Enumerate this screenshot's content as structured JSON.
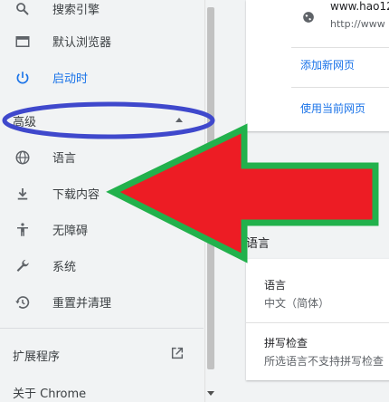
{
  "sidebar": {
    "items": [
      {
        "label": "搜索引擎",
        "icon": "search-icon"
      },
      {
        "label": "默认浏览器",
        "icon": "browser-window-icon"
      },
      {
        "label": "启动时",
        "icon": "power-icon"
      }
    ],
    "advanced": {
      "label": "高级",
      "icon": "chevron-up-icon"
    },
    "advanced_items": [
      {
        "label": "语言",
        "icon": "globe-icon"
      },
      {
        "label": "下载内容",
        "icon": "download-icon"
      },
      {
        "label": "无障碍",
        "icon": "accessibility-icon"
      },
      {
        "label": "系统",
        "icon": "wrench-icon"
      },
      {
        "label": "重置并清理",
        "icon": "restore-icon"
      }
    ],
    "extensions": {
      "label": "扩展程序",
      "icon": "open-in-new-icon"
    },
    "about": {
      "label": "关于 Chrome"
    }
  },
  "startup_card": {
    "page_url": "www.hao12",
    "page_url_sub": "http://www",
    "add_page_link": "添加新网页",
    "use_current_link": "使用当前网页"
  },
  "languages_section": {
    "title": "语言",
    "language_row": {
      "title": "语言",
      "value": "中文（简体）"
    },
    "spellcheck_row": {
      "title": "拼写检查",
      "value": "所选语言不支持拼写检查"
    }
  },
  "annotation": {
    "arrow_color": "#ed1c24",
    "arrow_border": "#22b14c",
    "ellipse_color": "#3f48cc"
  },
  "colors": {
    "accent": "#1a73e8",
    "background": "#f1f3f4"
  }
}
